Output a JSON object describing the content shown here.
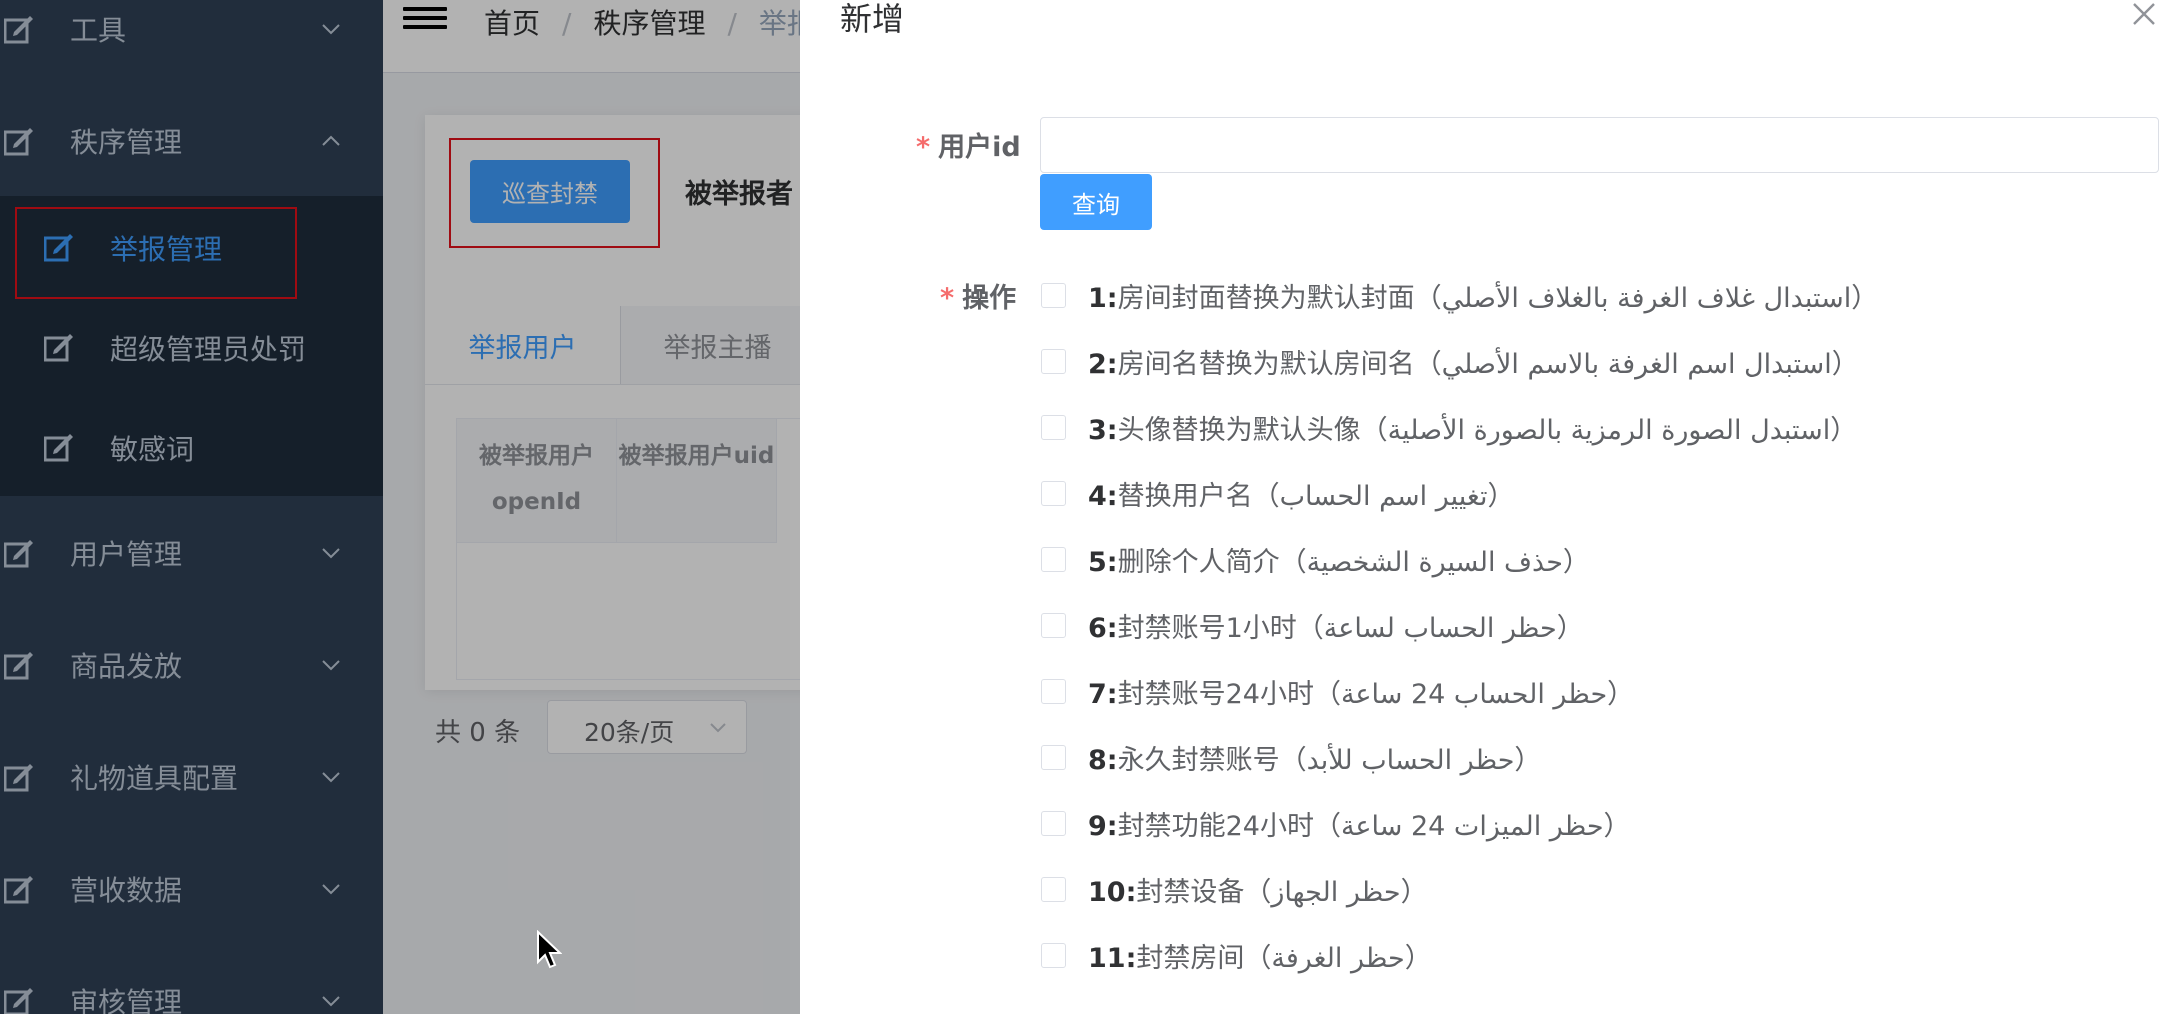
{
  "sidebar": {
    "menus": [
      {
        "label": "工具",
        "expanded": false
      },
      {
        "label": "秩序管理",
        "expanded": true
      },
      {
        "label": "用户管理",
        "expanded": false
      },
      {
        "label": "商品发放",
        "expanded": false
      },
      {
        "label": "礼物道具配置",
        "expanded": false
      },
      {
        "label": "营收数据",
        "expanded": false
      },
      {
        "label": "审核管理",
        "expanded": false
      }
    ],
    "submenu": [
      {
        "label": "举报管理",
        "active": true
      },
      {
        "label": "超级管理员处罚",
        "active": false
      },
      {
        "label": "敏感词",
        "active": false
      }
    ]
  },
  "breadcrumb": [
    "首页",
    "秩序管理",
    "举报"
  ],
  "main": {
    "patrol_button": "巡查封禁",
    "reported_label": "被举报者",
    "tabs": [
      "举报用户",
      "举报主播"
    ],
    "table_headers": [
      "被举报用户openId",
      "被举报用户uid"
    ],
    "pager_total": "共 0 条",
    "pager_size": "20条/页"
  },
  "drawer": {
    "title": "新增",
    "user_id_label": "用户id",
    "user_id_value": "",
    "query_button": "查询",
    "operation_label": "操作",
    "operations": [
      {
        "num": "1:",
        "text": "房间封面替换为默认封面（استبدال غلاف الغرفة بالغلاف الأصلي）"
      },
      {
        "num": "2:",
        "text": "房间名替换为默认房间名（استبدال اسم الغرفة بالاسم الأصلي）"
      },
      {
        "num": "3:",
        "text": "头像替换为默认头像（استبدل الصورة الرمزية بالصورة الأصلية）"
      },
      {
        "num": "4:",
        "text": "替换用户名（تغيير اسم الحساب）"
      },
      {
        "num": "5:",
        "text": "删除个人简介（حذف السيرة الشخصية）"
      },
      {
        "num": "6:",
        "text": "封禁账号1小时（حظر الحساب لساعة）"
      },
      {
        "num": "7:",
        "text": "封禁账号24小时（حظر الحساب 24 ساعة）"
      },
      {
        "num": "8:",
        "text": "永久封禁账号（حظر الحساب للأبد）"
      },
      {
        "num": "9:",
        "text": "封禁功能24小时（حظر الميزات 24 ساعة）"
      },
      {
        "num": "10:",
        "text": "封禁设备（حظر الجهاز）"
      },
      {
        "num": "11:",
        "text": "封禁房间（حظر الغرفة）"
      }
    ]
  },
  "colors": {
    "sidebar_bg": "#304156",
    "submenu_bg": "#1f2d3d",
    "accent": "#409eff",
    "highlight_box": "#e4101a"
  },
  "icons": [
    "edit-icon",
    "chevron-down-icon",
    "chevron-up-icon",
    "hamburger-icon",
    "close-icon",
    "cursor-icon"
  ]
}
